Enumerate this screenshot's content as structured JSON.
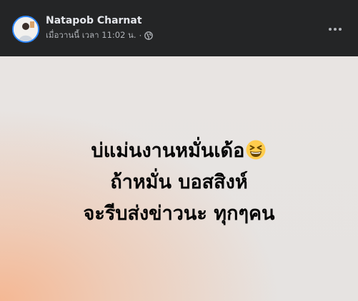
{
  "post": {
    "author": "Natapob Charnat",
    "timestamp": "เมื่อวานนี้ เวลา 11:02 น.",
    "separator": "·",
    "privacy_icon": "globe-icon",
    "more_icon": "more-options-icon",
    "body_lines": [
      "บ่แม่นงานหมั่นเด้อ",
      "ถ้าหมั่น บอสสิงห์",
      "จะรีบส่งข่าวนะ ทุกๆคน"
    ],
    "emoji": "grinning-squinting-face-icon"
  },
  "colors": {
    "header_bg": "#242526",
    "name_text": "#e4e6eb",
    "meta_text": "#b0b3b8",
    "body_text": "#050505",
    "gradient_corner": "#f5b894",
    "gradient_base": "#e6e3e1",
    "emoji_yellow": "#ffcc4d"
  }
}
